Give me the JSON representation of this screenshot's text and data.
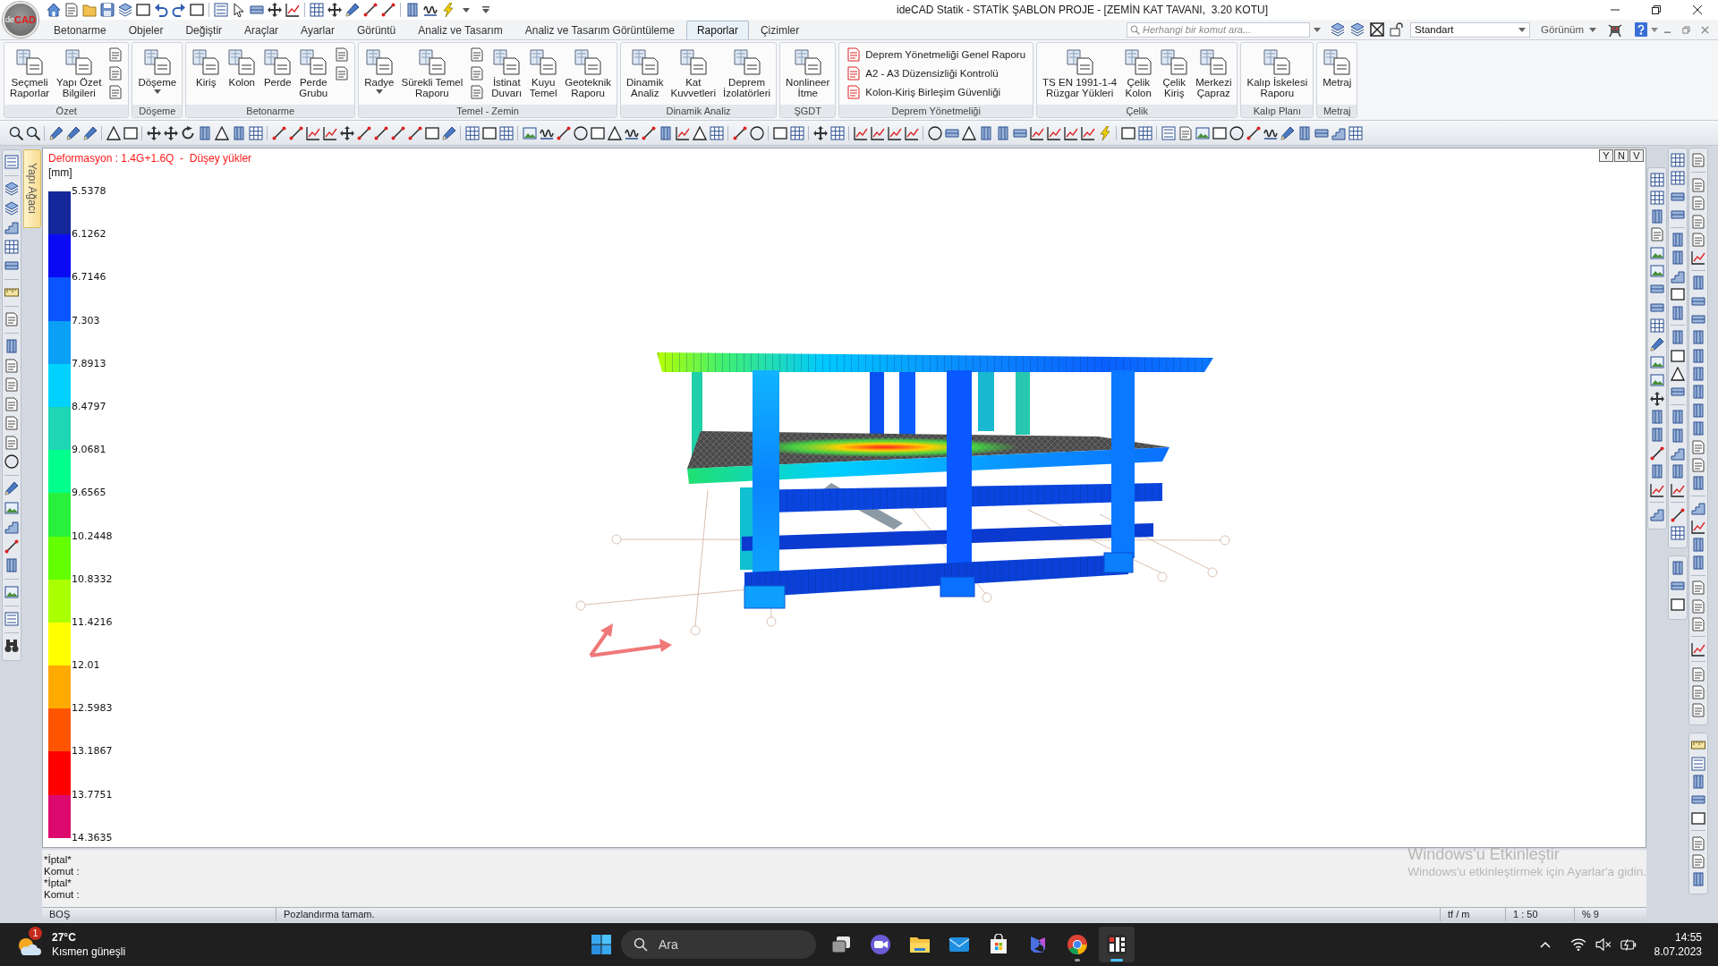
{
  "window": {
    "title": "ideCAD Statik - STATİK ŞABLON PROJE - [ZEMİN KAT TAVANI,  3.20 KOTU]"
  },
  "app_button": {
    "prefix": "de",
    "name": "CAD"
  },
  "tabs": [
    {
      "label": "Betonarme",
      "selected": false
    },
    {
      "label": "Objeler",
      "selected": false
    },
    {
      "label": "Değiştir",
      "selected": false
    },
    {
      "label": "Araçlar",
      "selected": false
    },
    {
      "label": "Ayarlar",
      "selected": false
    },
    {
      "label": "Görüntü",
      "selected": false
    },
    {
      "label": "Analiz ve Tasarım",
      "selected": false
    },
    {
      "label": "Analiz ve Tasarım Görüntüleme",
      "selected": false
    },
    {
      "label": "Raporlar",
      "selected": true
    },
    {
      "label": "Çizimler",
      "selected": false
    }
  ],
  "search": {
    "placeholder": "Herhangi bir komut ara..."
  },
  "style_selector": {
    "value": "Standart"
  },
  "view_menu": {
    "label": "Görünüm"
  },
  "ribbon": {
    "groups": [
      {
        "title": "Özet",
        "items": [
          {
            "kind": "large",
            "label": "Seçmeli\nRaporlar"
          },
          {
            "kind": "large",
            "label": "Yapı Özet\nBilgileri"
          },
          {
            "kind": "small"
          },
          {
            "kind": "small"
          },
          {
            "kind": "small"
          }
        ]
      },
      {
        "title": "Döşeme",
        "items": [
          {
            "kind": "large_dropdown",
            "label": "Döşeme"
          }
        ]
      },
      {
        "title": "Betonarme",
        "items": [
          {
            "kind": "large",
            "label": "Kiriş"
          },
          {
            "kind": "large",
            "label": "Kolon"
          },
          {
            "kind": "large",
            "label": "Perde"
          },
          {
            "kind": "large",
            "label": "Perde\nGrubu"
          },
          {
            "kind": "small"
          },
          {
            "kind": "small"
          }
        ]
      },
      {
        "title": "Temel - Zemin",
        "items": [
          {
            "kind": "large_dropdown",
            "label": "Radye"
          },
          {
            "kind": "large",
            "label": "Sürekli Temel\nRaporu"
          },
          {
            "kind": "small"
          },
          {
            "kind": "small"
          },
          {
            "kind": "small"
          },
          {
            "kind": "large",
            "label": "İstinat\nDuvarı"
          },
          {
            "kind": "large",
            "label": "Kuyu\nTemel"
          },
          {
            "kind": "large",
            "label": "Geoteknik\nRaporu"
          }
        ]
      },
      {
        "title": "Dinamik Analiz",
        "items": [
          {
            "kind": "large",
            "label": "Dinamik\nAnaliz"
          },
          {
            "kind": "large",
            "label": "Kat\nKuvvetleri"
          },
          {
            "kind": "large",
            "label": "Deprem\nİzolatörleri"
          }
        ]
      },
      {
        "title": "ŞGDT",
        "items": [
          {
            "kind": "large",
            "label": "Nonlineer\nİtme"
          }
        ]
      },
      {
        "title": "Deprem Yönetmeliği",
        "items": [
          {
            "kind": "list",
            "label": "Deprem Yönetmeliği Genel Raporu"
          },
          {
            "kind": "list",
            "label": "A2 - A3 Düzensizliği Kontrolü"
          },
          {
            "kind": "list",
            "label": "Kolon-Kiriş Birleşim Güvenliği"
          }
        ]
      },
      {
        "title": "Çelik",
        "items": [
          {
            "kind": "large",
            "label": "TS EN 1991-1-4\nRüzgar Yükleri"
          },
          {
            "kind": "large",
            "label": "Çelik\nKolon"
          },
          {
            "kind": "large",
            "label": "Çelik\nKiriş"
          },
          {
            "kind": "large",
            "label": "Merkezi\nÇapraz"
          }
        ]
      },
      {
        "title": "Kalıp Planı",
        "items": [
          {
            "kind": "large",
            "label": "Kalıp İskelesi\nRaporu"
          }
        ]
      },
      {
        "title": "Metraj",
        "items": [
          {
            "kind": "large",
            "label": "Metraj"
          }
        ]
      }
    ]
  },
  "side_tab": {
    "label": "Yapı Ağacı"
  },
  "viewport": {
    "title": "Deformasyon : 1.4G+1.6Q  -  Düşey yükler",
    "unit": "[mm]",
    "view_buttons": [
      {
        "label": "Y"
      },
      {
        "label": "N"
      },
      {
        "label": "V"
      }
    ],
    "legend": {
      "bands": [
        {
          "label": "5.5378",
          "color": "#13279a"
        },
        {
          "label": "6.1262",
          "color": "#0a0af5"
        },
        {
          "label": "6.7146",
          "color": "#0a55ff"
        },
        {
          "label": "7.303",
          "color": "#0aa0f5"
        },
        {
          "label": "7.8913",
          "color": "#00d2ff"
        },
        {
          "label": "8.4797",
          "color": "#1ed6b4"
        },
        {
          "label": "9.0681",
          "color": "#00ff8c"
        },
        {
          "label": "9.6565",
          "color": "#28f03c"
        },
        {
          "label": "10.2448",
          "color": "#64ff00"
        },
        {
          "label": "10.8332",
          "color": "#aaff00"
        },
        {
          "label": "11.4216",
          "color": "#ffff00"
        },
        {
          "label": "12.01",
          "color": "#ffaa00"
        },
        {
          "label": "12.5983",
          "color": "#ff5500"
        },
        {
          "label": "13.1867",
          "color": "#ff0000"
        },
        {
          "label": "13.7751",
          "color": "#dc0a6e"
        }
      ],
      "end_label": "14.3635"
    }
  },
  "command_log": [
    "*İptal*",
    "Komut :",
    "*İptal*",
    "Komut :"
  ],
  "activation_notice": {
    "title": "Windows'u Etkinleştir",
    "message": "Windows'u etkinleştirmek için Ayarlar'a gidin."
  },
  "status_bar": [
    "BOŞ",
    "Pozlandırma tamam.",
    "tf / m",
    "1 : 50",
    "% 9"
  ],
  "taskbar": {
    "weather": {
      "badge": "1",
      "temperature": "27°C",
      "condition": "Kısmen güneşli"
    },
    "search": {
      "placeholder": "Ara"
    },
    "apps": [
      {
        "kind": "task_view",
        "running": false,
        "selected": false
      },
      {
        "kind": "video_chat",
        "running": false,
        "selected": false
      },
      {
        "kind": "file_explorer",
        "running": false,
        "selected": false
      },
      {
        "kind": "mail",
        "running": false,
        "selected": false
      },
      {
        "kind": "store",
        "running": false,
        "selected": false
      },
      {
        "kind": "assistant",
        "running": false,
        "selected": false
      },
      {
        "kind": "browser",
        "running": true,
        "selected": false
      },
      {
        "kind": "cad_app",
        "running": true,
        "selected": true
      }
    ],
    "clock": {
      "time": "14:55",
      "date": "8.07.2023"
    }
  }
}
